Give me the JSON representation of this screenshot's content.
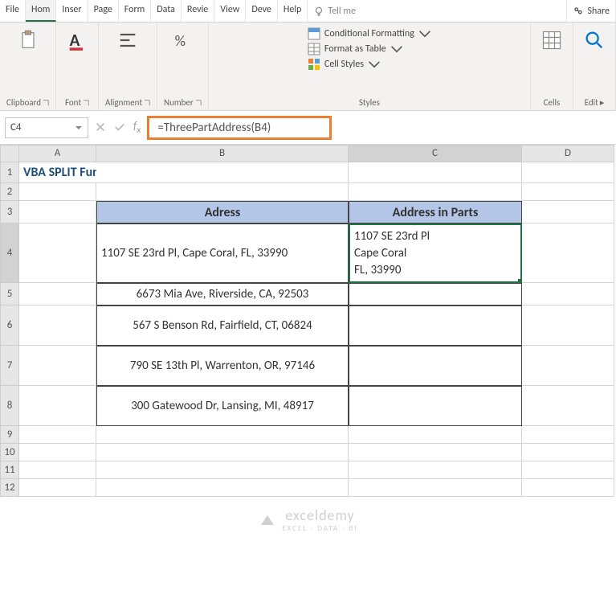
{
  "tabs": {
    "file": "File",
    "home": "Hom",
    "insert": "Inser",
    "page": "Page",
    "formulas": "Form",
    "data": "Data",
    "review": "Revie",
    "view": "View",
    "dev": "Deve",
    "help": "Help",
    "tell": "Tell me",
    "share": "Share"
  },
  "ribbon": {
    "clipboard": "Clipboard",
    "font": "Font",
    "alignment": "Alignment",
    "number": "Number",
    "styles": "Styles",
    "cells": "Cells",
    "edit": "Edit",
    "cond_format": "Conditional Formatting",
    "format_table": "Format as Table",
    "cell_styles": "Cell Styles"
  },
  "namebox": "C4",
  "formula": "=ThreePartAddress(B4)",
  "sheet": {
    "title": "VBA SPLIT Function",
    "header_b": "Adress",
    "header_c": "Address in Parts",
    "rows": [
      {
        "b": "1107 SE 23rd Pl, Cape Coral, FL, 33990",
        "c": "1107 SE 23rd Pl\nCape Coral\nFL, 33990"
      },
      {
        "b": "6673 Mia Ave, Riverside, CA, 92503",
        "c": ""
      },
      {
        "b": "567 S Benson Rd, Fairfield, CT, 06824",
        "c": ""
      },
      {
        "b": "790 SE 13th Pl, Warrenton, OR, 97146",
        "c": ""
      },
      {
        "b": "300 Gatewood Dr, Lansing, MI, 48917",
        "c": ""
      }
    ],
    "cols": [
      "A",
      "B",
      "C",
      "D"
    ]
  },
  "watermark": {
    "main": "exceldemy",
    "sub": "EXCEL · DATA · BI"
  }
}
